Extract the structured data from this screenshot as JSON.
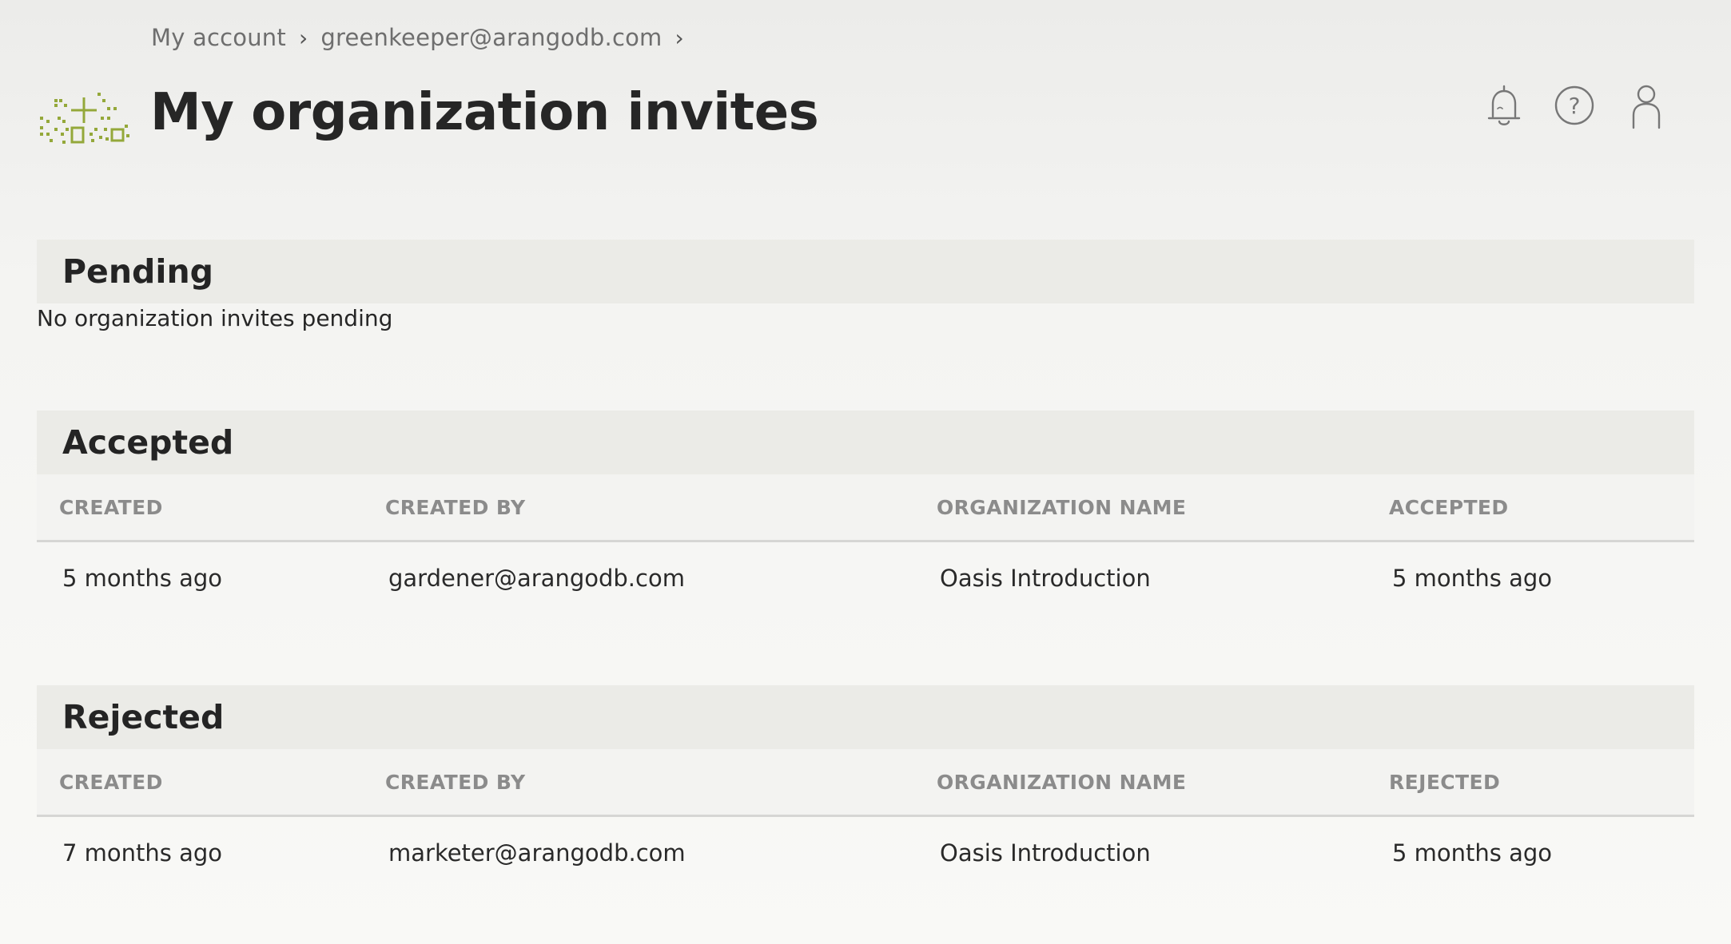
{
  "breadcrumb": {
    "items": [
      "My account",
      "greenkeeper@arangodb.com"
    ],
    "separator": "›"
  },
  "header": {
    "title": "My organization invites",
    "icons": [
      "bell-icon",
      "help-icon",
      "user-icon"
    ]
  },
  "colors": {
    "logo_accent": "#94a83a",
    "muted_text": "#8b8b8b",
    "section_header_bg": "#ebebe7"
  },
  "pending": {
    "title": "Pending",
    "empty_message": "No organization invites pending"
  },
  "accepted": {
    "title": "Accepted",
    "columns": [
      "CREATED",
      "CREATED BY",
      "ORGANIZATION NAME",
      "ACCEPTED"
    ],
    "rows": [
      [
        "5 months ago",
        "gardener@arangodb.com",
        "Oasis Introduction",
        "5 months ago"
      ]
    ]
  },
  "rejected": {
    "title": "Rejected",
    "columns": [
      "CREATED",
      "CREATED BY",
      "ORGANIZATION NAME",
      "REJECTED"
    ],
    "rows": [
      [
        "7 months ago",
        "marketer@arangodb.com",
        "Oasis Introduction",
        "5 months ago"
      ]
    ]
  }
}
